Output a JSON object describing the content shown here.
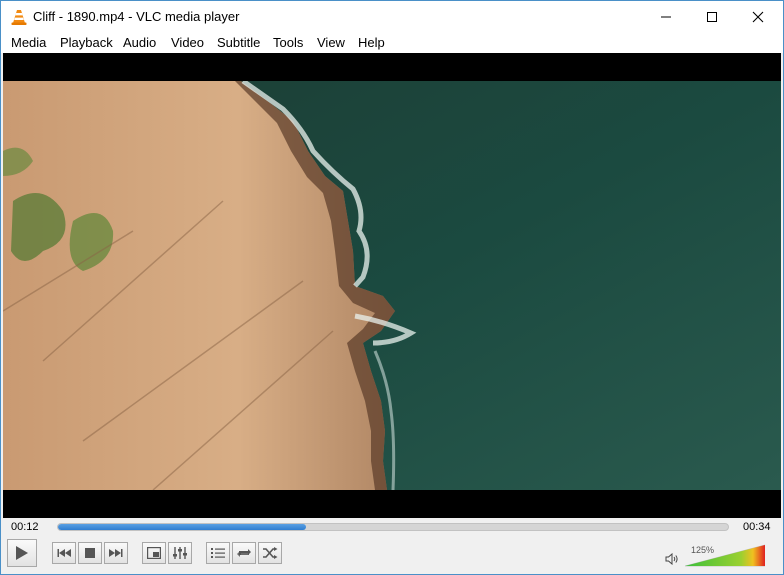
{
  "window": {
    "title": "Cliff - 1890.mp4 - VLC media player",
    "app_icon": "vlc-cone-icon",
    "controls": [
      "minimize-icon",
      "maximize-icon",
      "close-icon"
    ]
  },
  "menu": {
    "items": [
      {
        "label": "Media"
      },
      {
        "label": "Playback"
      },
      {
        "label": "Audio"
      },
      {
        "label": "Video"
      },
      {
        "label": "Subtitle"
      },
      {
        "label": "Tools"
      },
      {
        "label": "View"
      },
      {
        "label": "Help"
      }
    ]
  },
  "playback": {
    "elapsed": "00:12",
    "total": "00:34",
    "position_fraction": 0.37
  },
  "controls": {
    "buttons": [
      "play-icon",
      "previous-icon",
      "stop-icon",
      "next-icon",
      "fullscreen-icon",
      "extended-settings-icon",
      "playlist-icon",
      "loop-icon",
      "shuffle-icon"
    ]
  },
  "volume": {
    "label": "125%",
    "level_fraction": 1.0,
    "icon": "speaker-icon"
  },
  "colors": {
    "seek_fill": "#2f7dd0",
    "volume_low": "#2ca02c",
    "volume_high": "#e02020"
  }
}
